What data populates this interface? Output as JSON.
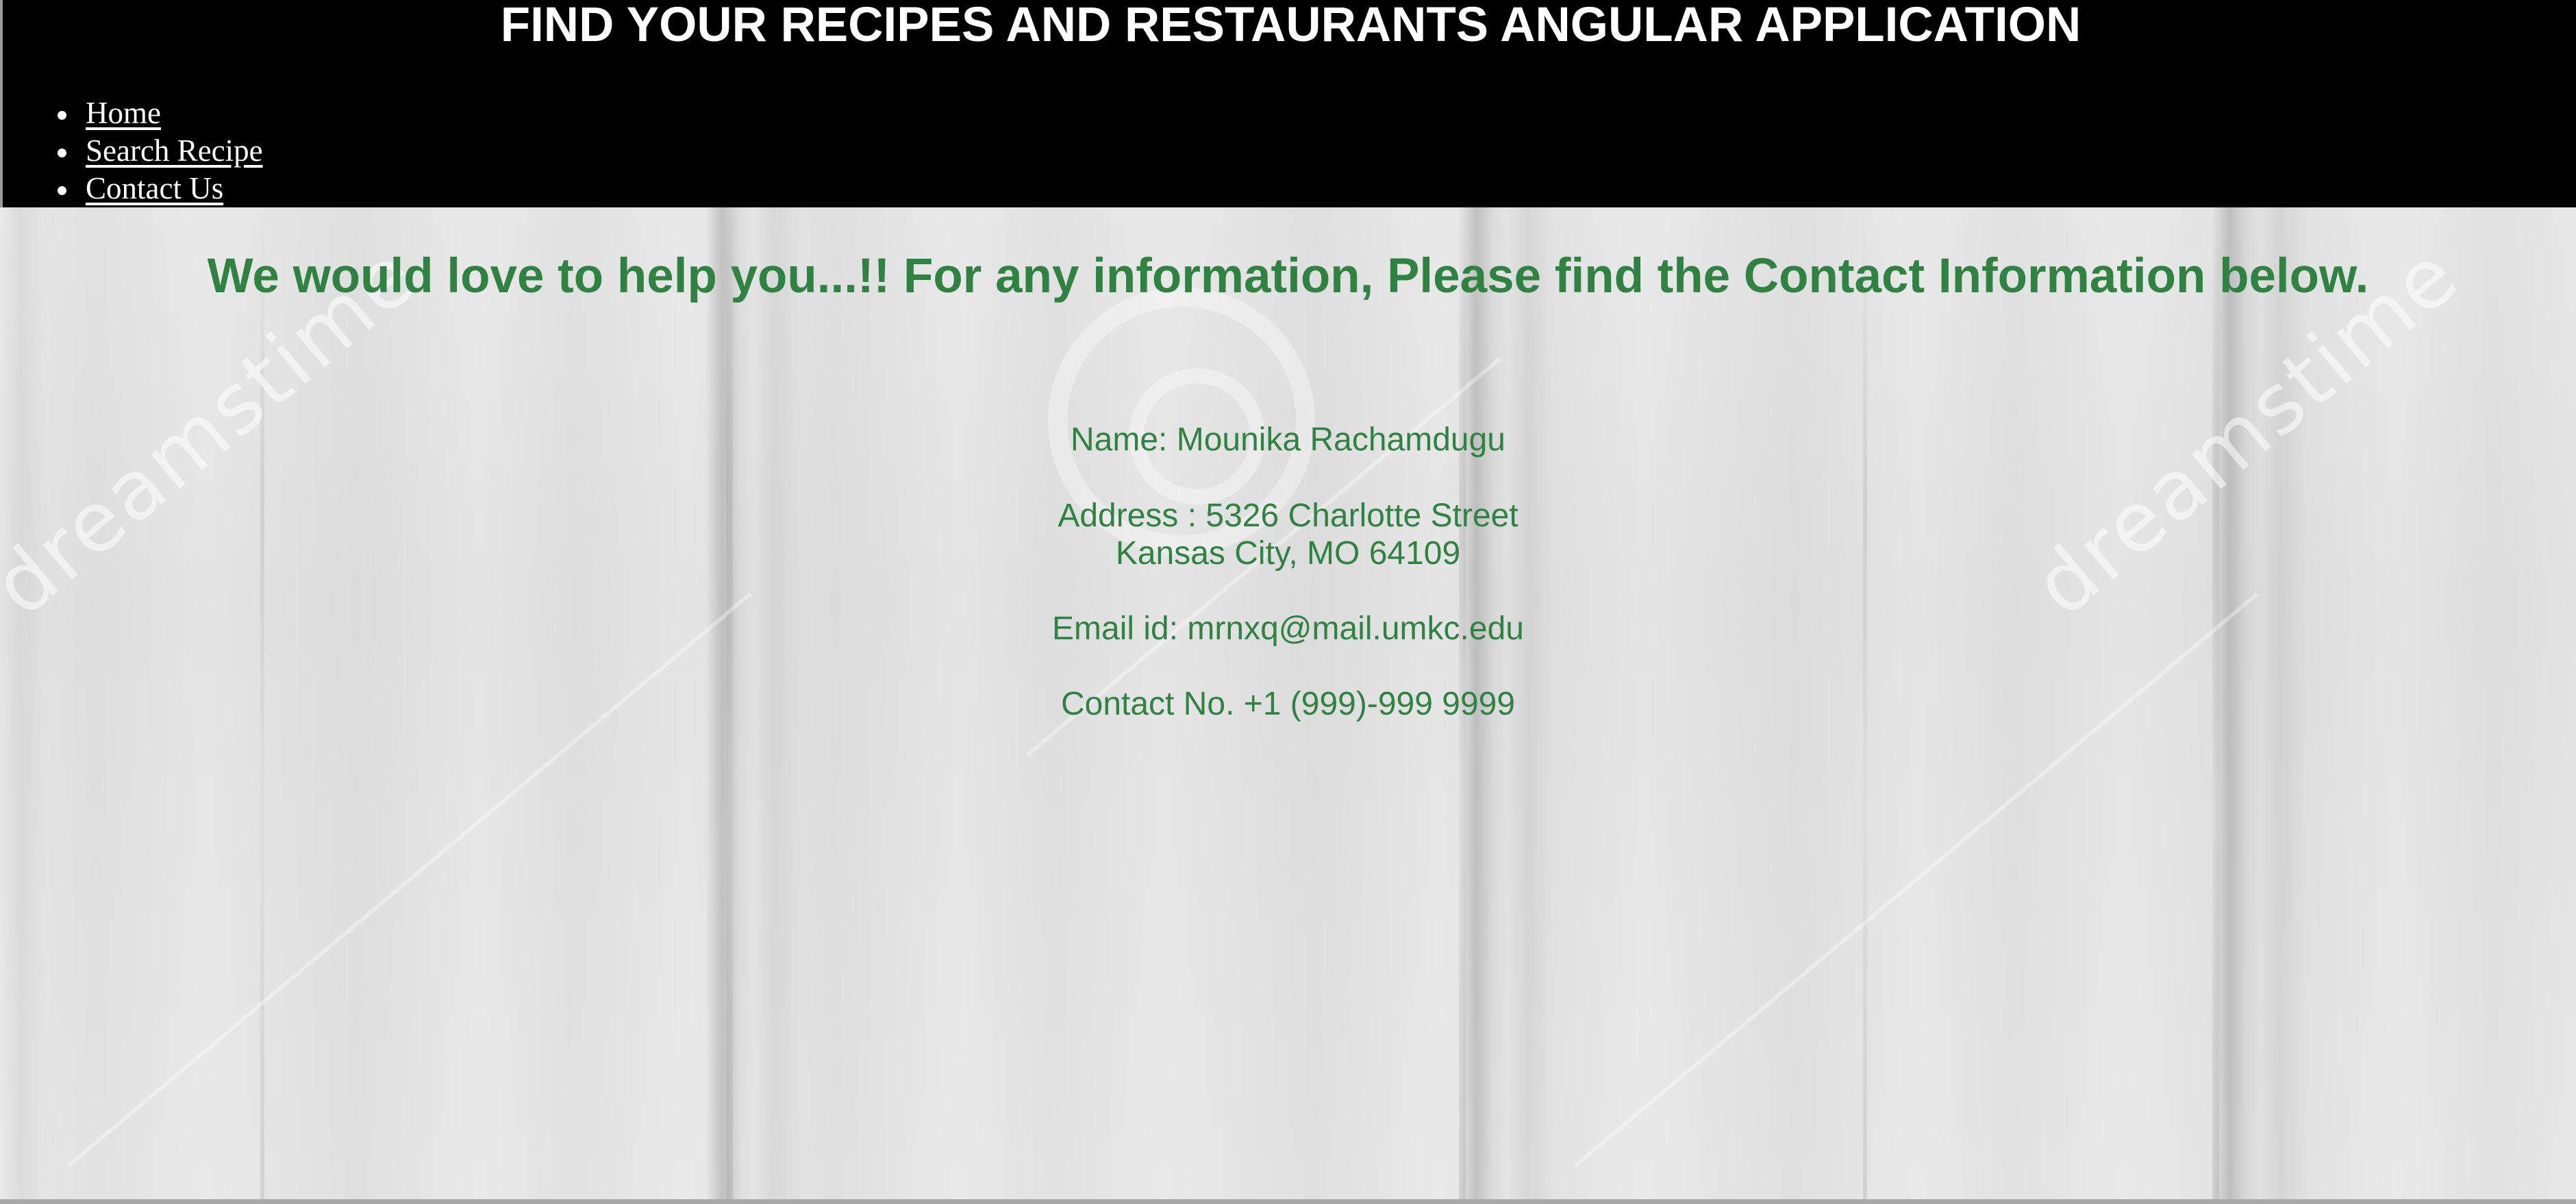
{
  "header": {
    "title": "FIND YOUR RECIPES AND RESTAURANTS ANGULAR APPLICATION",
    "nav": [
      {
        "label": "Home"
      },
      {
        "label": "Search Recipe"
      },
      {
        "label": "Contact Us"
      }
    ]
  },
  "main": {
    "headline": "We would love to help you...!! For any information, Please find the Contact Information below.",
    "contact": {
      "name": "Name: Mounika Rachamdugu",
      "address_line1": "Address : 5326 Charlotte Street",
      "address_line2": "Kansas City, MO 64109",
      "email": "Email id: mrnxq@mail.umkc.edu",
      "phone": "Contact No. +1 (999)-999 9999"
    }
  },
  "background": {
    "watermark_text": "dreamstime"
  },
  "colors": {
    "header_bg": "#000000",
    "header_text": "#ffffff",
    "accent_green": "#2f8241",
    "page_bg": "#e6e6e6"
  }
}
